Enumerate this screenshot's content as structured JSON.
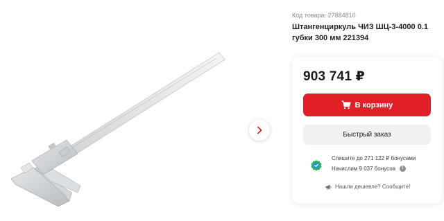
{
  "product": {
    "code_label": "Код товара:",
    "code_value": "27884810",
    "title": "Штангенциркуль ЧИЗ ШЦ-3-4000 0.1 губки 300 мм 221394"
  },
  "icons": {
    "next": "chevron-right-icon",
    "cart": "shopping-cart-icon",
    "bonus": "bonus-check-icon",
    "info": "info-icon",
    "cheaper": "megaphone-icon"
  },
  "colors": {
    "accent": "#e01f26",
    "bonus_green": "#2db35c",
    "bonus_blue": "#2a8be0",
    "secondary_button": "#f0f1f3"
  },
  "buy": {
    "price": "903 741 ₽",
    "cart_label": "В корзину",
    "quick_order_label": "Быстрый заказ"
  },
  "bonus": {
    "spend_text": "Спишите до 271 122 ₽ бонусами",
    "earn_text": "Начислим 9 037 бонусов",
    "info_glyph": "i"
  },
  "cheaper": {
    "text": "Нашли дешевле? Сообщите!"
  }
}
